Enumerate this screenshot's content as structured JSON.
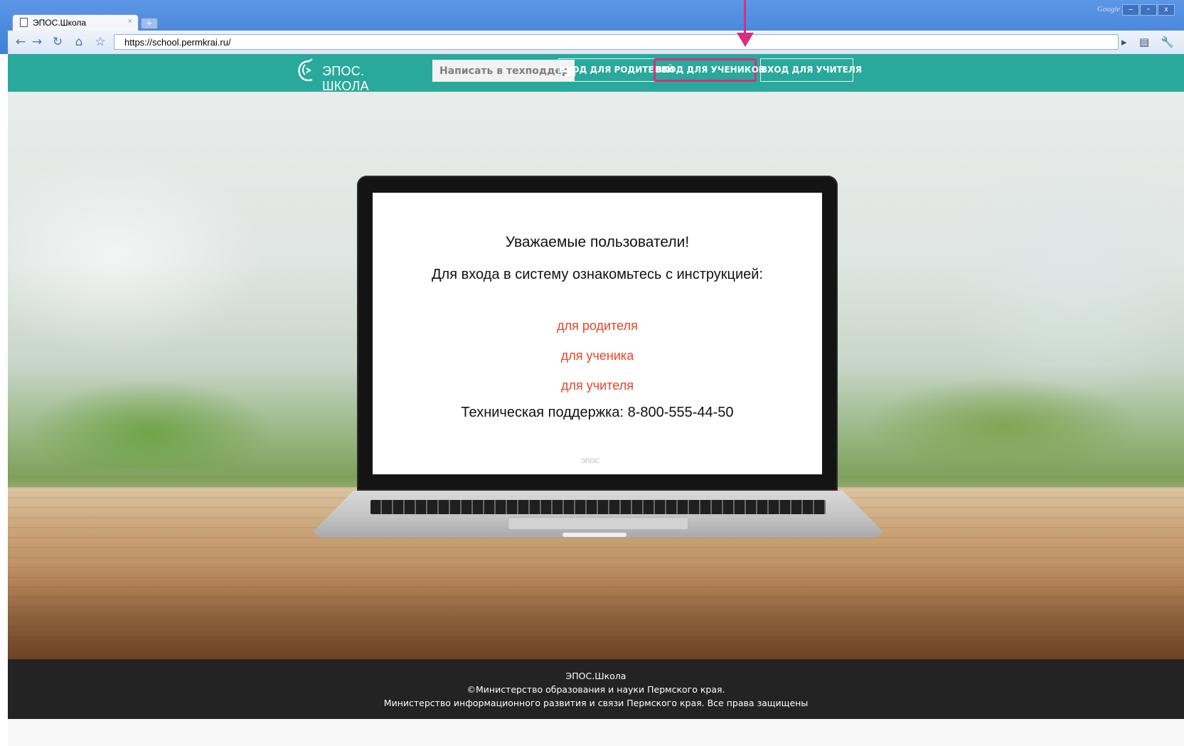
{
  "browser": {
    "tab_title": "ЭПОС.Школа",
    "tab_close": "×",
    "new_tab": "+",
    "url": "https://school.permkrai.ru/",
    "brand": "Google",
    "window_controls": [
      "–",
      "▫",
      "x"
    ]
  },
  "header": {
    "logo_text": "ЭПОС. ШКОЛА",
    "support_placeholder": "Написать в техподдержку",
    "buttons": [
      {
        "label": "ВХОД ДЛЯ РОДИТЕЛЕЙ",
        "active": false
      },
      {
        "label": "ВХОД ДЛЯ УЧЕНИКОВ",
        "active": true
      },
      {
        "label": "ВХОД ДЛЯ УЧИТЕЛЯ",
        "active": false
      }
    ],
    "colors": {
      "bar": "#29a99b",
      "highlight": "#d6307e"
    }
  },
  "screen": {
    "heading": "Уважаемые пользователи!",
    "intro": "Для входа в систему ознакомьтесь с инструкцией:",
    "link_parent": "для родителя",
    "link_student": "для ученика",
    "link_teacher": "для учителя",
    "support": "Техническая поддержка: 8-800-555-44-50",
    "link_color": "#e8452a"
  },
  "laptop_brand": "ЭПОС",
  "footer": {
    "line1": "ЭПОС.Школа",
    "line2": "©Министерство образования и науки Пермского края.",
    "line3": "Министерство информационного развития и связи Пермского края. Все права защищены"
  }
}
